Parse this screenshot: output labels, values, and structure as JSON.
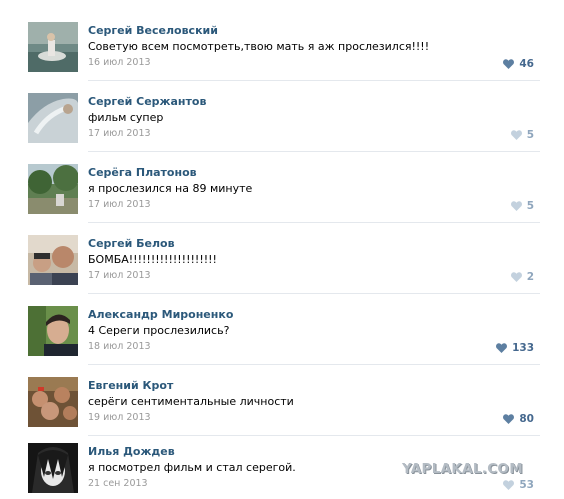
{
  "comments": [
    {
      "author": "Сергей Веселовский",
      "text": "Советую всем посмотреть,твою мать я аж прослезился!!!!",
      "date": "16 июл 2013",
      "likes": "46",
      "liked": true
    },
    {
      "author": "Сергей Сержантов",
      "text": "фильм супер",
      "date": "17 июл 2013",
      "likes": "5",
      "liked": false
    },
    {
      "author": "Серёга Платонов",
      "text": "я прослезился на 89 минуте",
      "date": "17 июл 2013",
      "likes": "5",
      "liked": false
    },
    {
      "author": "Сергей Белов",
      "text": "БОМБА!!!!!!!!!!!!!!!!!!!!",
      "date": "17 июл 2013",
      "likes": "2",
      "liked": false
    },
    {
      "author": "Александр Мироненко",
      "text": "4 Сереги прослезились?",
      "date": "18 июл 2013",
      "likes": "133",
      "liked": true
    },
    {
      "author": "Евгений Крот",
      "text": "серёги сентиментальные личности",
      "date": "19 июл 2013",
      "likes": "80",
      "liked": true
    },
    {
      "author": "Илья Дождев",
      "text": "я посмотрел фильм и стал серегой.",
      "date": "21 сен 2013",
      "likes": "53",
      "liked": false
    }
  ],
  "watermark": "YAPLAKAL.COM",
  "colors": {
    "author": "#2b587a",
    "heart_active": "#5d7fa1",
    "heart_inactive": "#c3d1de",
    "divider": "#e4e8ed"
  },
  "icons": {
    "like": "heart-icon"
  }
}
